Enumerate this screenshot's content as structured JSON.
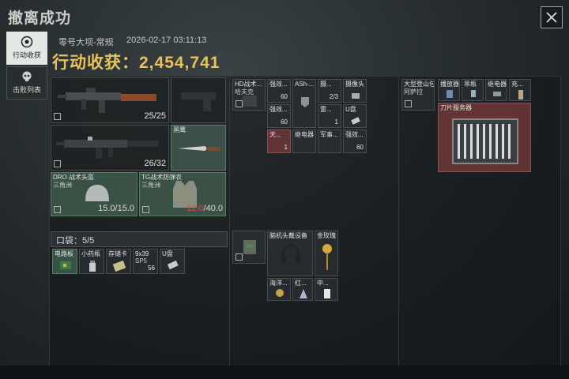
{
  "header": {
    "title": "撤离成功"
  },
  "tabs": [
    {
      "label": "行动收获",
      "icon": "target-icon",
      "active": true
    },
    {
      "label": "击败列表",
      "icon": "skull-icon",
      "active": false
    }
  ],
  "raid": {
    "map": "零号大坝-常规",
    "timestamp": "2026-02-17 03:11:13",
    "loot_label": "行动收获：2,454,741"
  },
  "equipment": {
    "primary": {
      "ammo": "25/25"
    },
    "secondary": {
      "ammo": "26/32"
    },
    "melee": {
      "name": "黑鹰"
    },
    "helmet": {
      "name": "DRO 战术头盔",
      "sub": "三角洲",
      "durability": "15.0/15.0"
    },
    "armor": {
      "name": "TG战术防弹衣",
      "sub": "三角洲",
      "durability_current": "12.0",
      "durability_max": "/40.0"
    }
  },
  "pocket": {
    "label": "口袋：5/5",
    "items": [
      {
        "name": "电路板"
      },
      {
        "name": "小药瓶"
      },
      {
        "name": "存储卡"
      },
      {
        "name": "9x39",
        "sub": "SP5",
        "count": "56"
      },
      {
        "name": "U盘"
      }
    ]
  },
  "rig": {
    "items": [
      {
        "name": "HD战术...",
        "sub": "哈夫克"
      },
      {
        "name": "强效...",
        "count": "60"
      },
      {
        "name": "ASh-..."
      },
      {
        "name": "摄...",
        "count": "2/3"
      },
      {
        "name": "摄像头"
      },
      {
        "name": "强效...",
        "count": "60"
      },
      {
        "name": "雷...",
        "count": "1"
      },
      {
        "name": "U盘"
      },
      {
        "name": "天...",
        "count": "1"
      },
      {
        "name": "继电器"
      },
      {
        "name": "军事..."
      },
      {
        "name": "强效...",
        "count": "60"
      }
    ]
  },
  "backpack": {
    "items": [
      {
        "name": "脑机头戴设备"
      },
      {
        "name": "金玫瑰"
      },
      {
        "name": "海洋..."
      },
      {
        "name": "红..."
      },
      {
        "name": "中..."
      }
    ]
  },
  "safebox": {
    "items": [
      {
        "name": "大型登山包",
        "sub": "阿萨拉"
      },
      {
        "name": "播放器"
      },
      {
        "name": "吊瓶"
      },
      {
        "name": "继电器"
      },
      {
        "name": "充..."
      },
      {
        "name": "刀片服务器"
      }
    ]
  }
}
